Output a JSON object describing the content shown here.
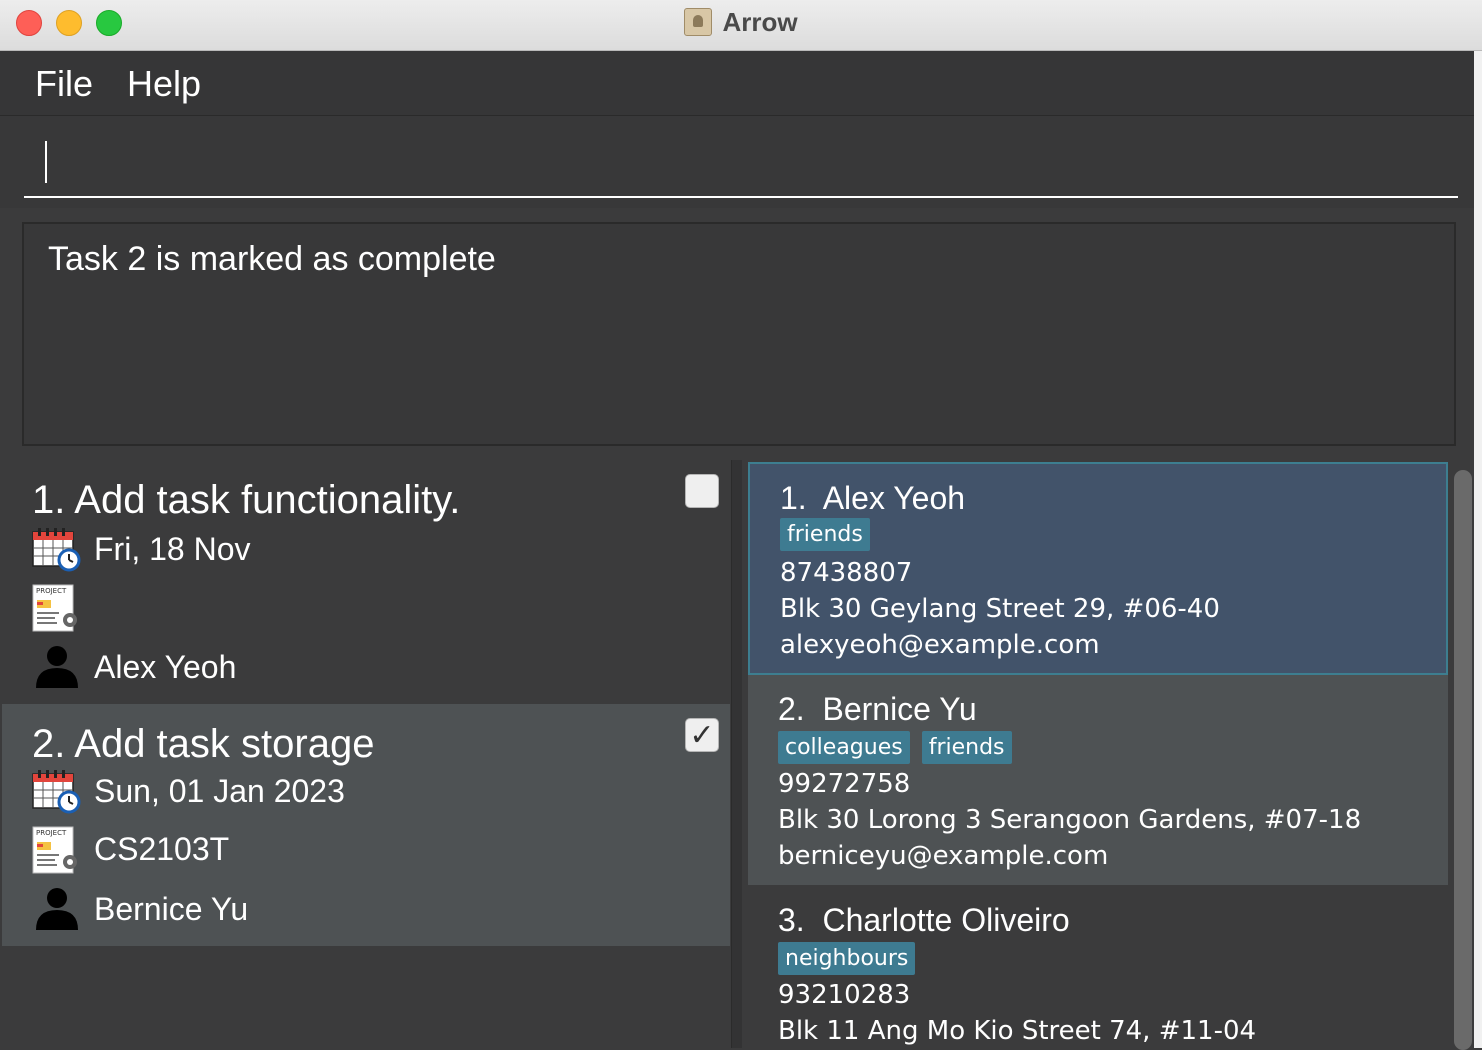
{
  "window": {
    "title": "Arrow"
  },
  "menu": {
    "items": [
      "File",
      "Help"
    ]
  },
  "command_box": {
    "value": "",
    "placeholder": ""
  },
  "result": {
    "message": "Task 2 is marked as complete"
  },
  "tasks": [
    {
      "title": "1. Add task functionality.",
      "date": "Fri, 18 Nov",
      "project": "",
      "assignee": "Alex Yeoh",
      "done": false
    },
    {
      "title": "2. Add task storage",
      "date": "Sun, 01 Jan 2023",
      "project": "CS2103T",
      "assignee": "Bernice Yu",
      "done": true
    }
  ],
  "persons": [
    {
      "index": "1.",
      "name": "Alex Yeoh",
      "tags": [
        "friends"
      ],
      "phone": "87438807",
      "address": "Blk 30 Geylang Street 29, #06-40",
      "email": "alexyeoh@example.com"
    },
    {
      "index": "2.",
      "name": "Bernice Yu",
      "tags": [
        "colleagues",
        "friends"
      ],
      "phone": "99272758",
      "address": "Blk 30 Lorong 3 Serangoon Gardens, #07-18",
      "email": "berniceyu@example.com"
    },
    {
      "index": "3.",
      "name": "Charlotte Oliveiro",
      "tags": [
        "neighbours"
      ],
      "phone": "93210283",
      "address": "Blk 11 Ang Mo Kio Street 74, #11-04",
      "email": ""
    }
  ],
  "icons": {
    "date": "calendar-clock-icon",
    "project": "project-document-icon",
    "assignee": "person-icon",
    "checked": "✓"
  },
  "colors": {
    "accent_tag": "#3e7b91",
    "selected_card": "#42536a",
    "background": "#3b3b3c"
  }
}
